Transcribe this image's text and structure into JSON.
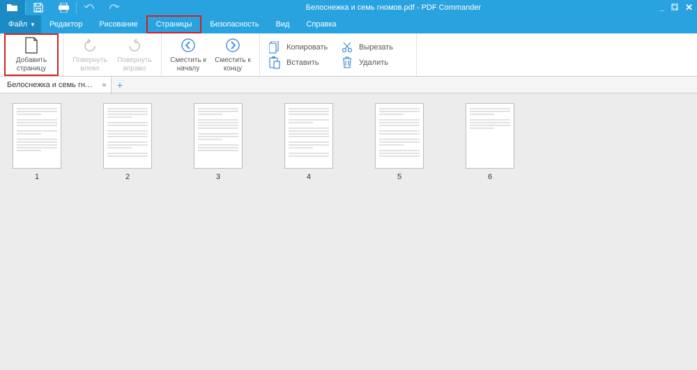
{
  "titlebar": {
    "title": "Белоснежка и семь гномов.pdf - PDF Commander"
  },
  "menubar": {
    "file": "Файл",
    "editor": "Редактор",
    "drawing": "Рисование",
    "pages": "Страницы",
    "security": "Безопасность",
    "view": "Вид",
    "help": "Справка"
  },
  "ribbon": {
    "add_page_l1": "Добавить",
    "add_page_l2": "страницу",
    "rotate_left_l1": "Повернуть",
    "rotate_left_l2": "влево",
    "rotate_right_l1": "Повернуть",
    "rotate_right_l2": "вправо",
    "shift_start_l1": "Сместить к",
    "shift_start_l2": "началу",
    "shift_end_l1": "Сместить к",
    "shift_end_l2": "концу",
    "copy": "Копировать",
    "paste": "Вставить",
    "cut": "Вырезать",
    "delete": "Удалить"
  },
  "tabs": {
    "doc_name": "Белоснежка и семь гном..."
  },
  "thumbs": {
    "labels": [
      "1",
      "2",
      "3",
      "4",
      "5",
      "6"
    ]
  }
}
